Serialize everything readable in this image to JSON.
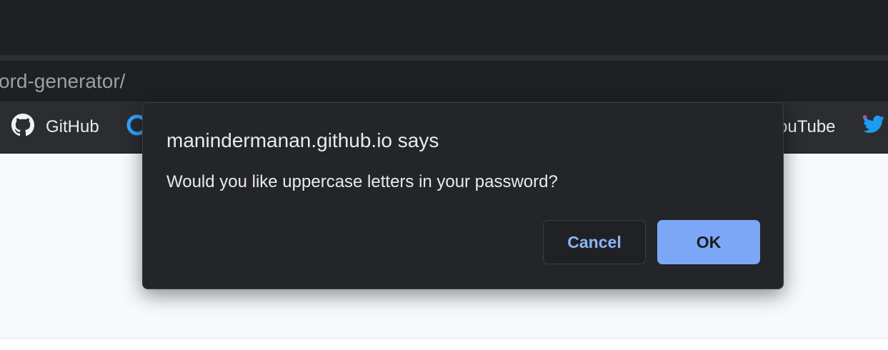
{
  "browser": {
    "url_partial": "ord-generator/",
    "bookmarks": [
      {
        "label": "GitHub",
        "icon": "github-icon"
      },
      {
        "label": "",
        "icon": "circle-icon"
      },
      {
        "label": "ouTube",
        "icon": "youtube-icon"
      },
      {
        "label": "",
        "icon": "twitter-icon"
      }
    ]
  },
  "dialog": {
    "title": "manindermanan.github.io says",
    "message": "Would you like uppercase letters in your password?",
    "cancel_label": "Cancel",
    "ok_label": "OK"
  },
  "colors": {
    "dialog_bg": "#242528",
    "accent": "#8ab4f8",
    "ok_bg": "#7ba7f6",
    "titlebar_bg": "#1f2023",
    "bookmarks_bg": "#2b2d31",
    "page_bg": "#f7f9fc"
  }
}
